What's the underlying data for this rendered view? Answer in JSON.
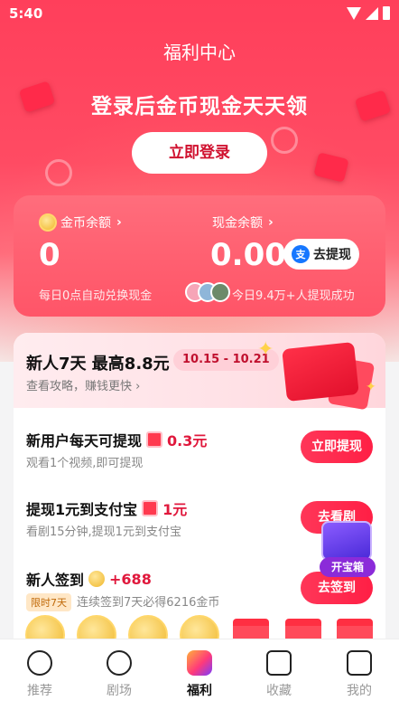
{
  "status_bar": {
    "time": "5:40"
  },
  "header": {
    "title": "福利中心",
    "headline": "登录后金币现金天天领",
    "login_button": "立即登录"
  },
  "balance": {
    "coin_label": "金币余额",
    "coin_value": "0",
    "coin_note": "每日0点自动兑换现金",
    "cash_label": "现金余额",
    "cash_value": "0.00",
    "withdraw_button": "去提现",
    "withdraw_note": "今日9.4万+人提现成功",
    "alipay_glyph": "支"
  },
  "newbie": {
    "title": "新人7天 最高8.8元",
    "date_range": "10.15 - 10.21",
    "subtitle": "查看攻略，赚钱更快"
  },
  "tasks": [
    {
      "title": "新用户每天可提现",
      "reward": "0.3元",
      "desc": "观看1个视频,即可提现",
      "button": "立即提现"
    },
    {
      "title": "提现1元到支付宝",
      "reward": "1元",
      "desc": "看剧15分钟,提现1元到支付宝",
      "button": "去看剧"
    },
    {
      "title": "新人签到",
      "reward": "+688",
      "tag": "限时7天",
      "desc": "连续签到7天必得6216金币",
      "button": "去签到"
    }
  ],
  "treasure_chest": {
    "label": "开宝箱"
  },
  "tabbar": {
    "items": [
      {
        "label": "推荐"
      },
      {
        "label": "剧场"
      },
      {
        "label": "福利"
      },
      {
        "label": "收藏"
      },
      {
        "label": "我的"
      }
    ],
    "active_index": 2
  },
  "colors": {
    "primary_red": "#ff3f5b",
    "button_red": "#ff1f45",
    "reward_red": "#e0183c",
    "gold": "#f0b72a"
  }
}
